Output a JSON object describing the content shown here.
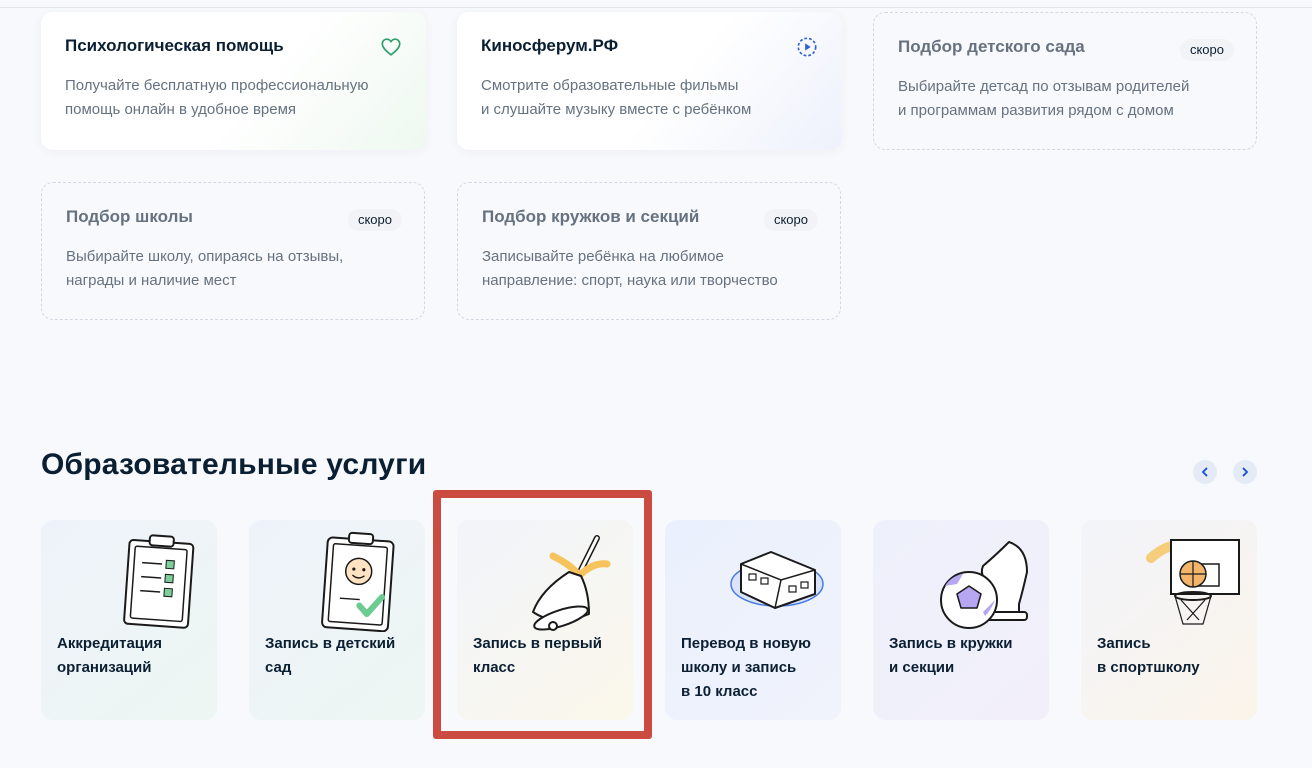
{
  "cards": [
    {
      "title": "Психологическая помощь",
      "desc": [
        "Получайте бесплатную профессиональную",
        "помощь онлайн в удобное время"
      ],
      "icon": "heart-icon"
    },
    {
      "title": "Киносферум.РФ",
      "desc": [
        "Смотрите образовательные фильмы",
        "и слушайте музыку вместе с ребёнком"
      ],
      "icon": "play-icon"
    },
    {
      "title": "Подбор детского сада",
      "badge": "скоро",
      "desc": [
        "Выбирайте детсад по отзывам родителей",
        "и программам развития рядом с домом"
      ]
    },
    {
      "title": "Подбор школы",
      "badge": "скоро",
      "desc": [
        "Выбирайте школу, опираясь на отзывы,",
        "награды и наличие мест"
      ]
    },
    {
      "title": "Подбор кружков и секций",
      "badge": "скоро",
      "desc": [
        "Записывайте ребёнка на любимое",
        "направление: спорт, наука или творчество"
      ]
    }
  ],
  "section": {
    "title": "Образовательные услуги",
    "prev_icon": "chevron-left-icon",
    "next_icon": "chevron-right-icon"
  },
  "services": [
    {
      "label": [
        "Аккредитация",
        "организаций"
      ],
      "icon": "clipboard-checklist-icon"
    },
    {
      "label": [
        "Запись в детский",
        "сад"
      ],
      "icon": "clipboard-child-icon"
    },
    {
      "label": [
        "Запись в первый",
        "класс"
      ],
      "icon": "school-bell-icon"
    },
    {
      "label": [
        "Перевод в новую",
        "школу и запись",
        "в 10 класс"
      ],
      "icon": "school-building-icon"
    },
    {
      "label": [
        "Запись в кружки",
        "и секции"
      ],
      "icon": "ball-chess-icon"
    },
    {
      "label": [
        "Запись",
        "в спортшколу"
      ],
      "icon": "basketball-hoop-icon"
    }
  ],
  "colors": {
    "background": "#f8f9fc",
    "text": "#0b1f33",
    "muted": "#66727f",
    "highlight": "#cc4b40",
    "accent": "#0d4cd3"
  }
}
